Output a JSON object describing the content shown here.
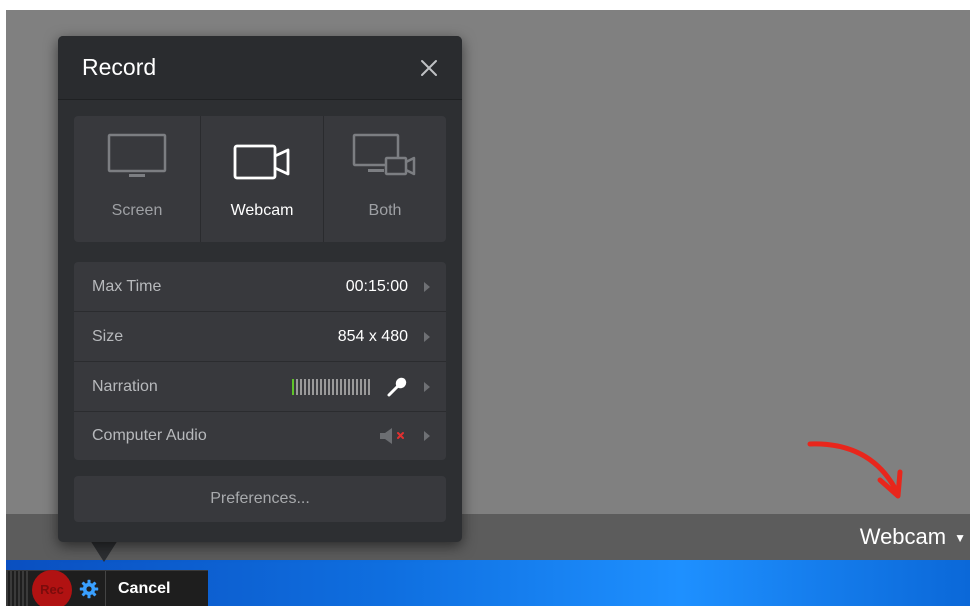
{
  "panel": {
    "title": "Record",
    "close_icon": "close-icon",
    "modes": [
      {
        "label": "Screen",
        "icon": "monitor-icon",
        "selected": false
      },
      {
        "label": "Webcam",
        "icon": "webcam-icon",
        "selected": true
      },
      {
        "label": "Both",
        "icon": "monitor-webcam-icon",
        "selected": false
      }
    ],
    "settings": [
      {
        "label": "Max Time",
        "value": "00:15:00"
      },
      {
        "label": "Size",
        "value": "854 x 480"
      },
      {
        "label": "Narration",
        "value": "",
        "icon": "microphone-icon"
      },
      {
        "label": "Computer Audio",
        "value": "",
        "icon": "speaker-muted-icon"
      }
    ],
    "preferences_label": "Preferences..."
  },
  "toolbar": {
    "rec_label": "Rec",
    "settings_icon": "gear-icon",
    "cancel_label": "Cancel"
  },
  "capture_source": {
    "label": "Webcam"
  },
  "colors": {
    "panel_bg": "#2d2f32",
    "meter_active": "#5fc32a",
    "muted_x": "#e03030",
    "rec_red": "#b11212",
    "annotation_arrow": "#e8261c",
    "taskbar_blue": "#1e90ff"
  }
}
